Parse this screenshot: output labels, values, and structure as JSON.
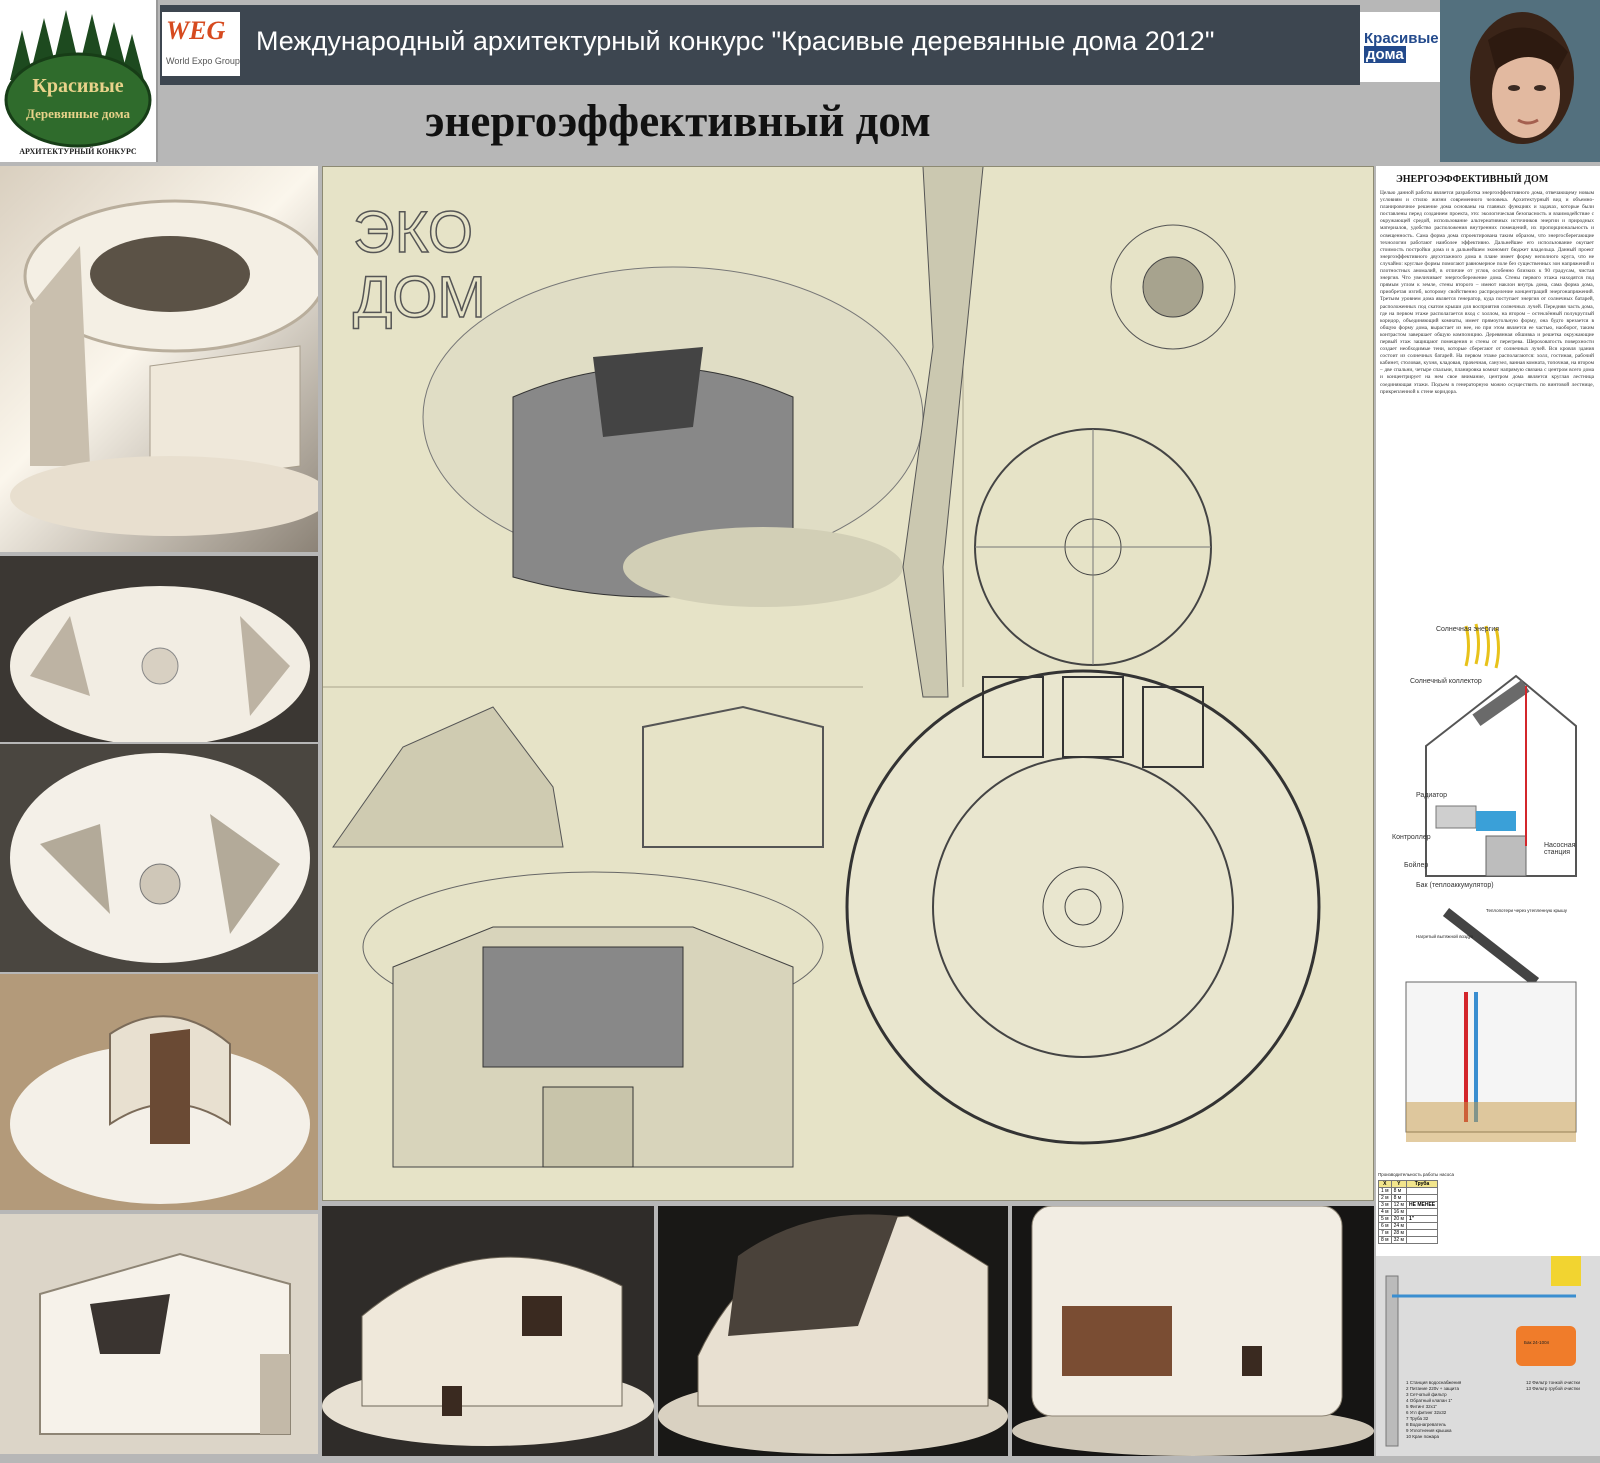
{
  "header": {
    "contest_title": "Международный архитектурный конкурс \"Красивые деревянные дома 2012\"",
    "page_title": "энергоэффективный дом",
    "left_logo": {
      "text_top": "Красивые",
      "text_bottom": "Деревянные дома",
      "caption": "АРХИТЕКТУРНЫЙ КОНКУРС"
    },
    "sponsor_logo": {
      "main": "WEG",
      "sub": "World Expo Group"
    },
    "magazine_logo": {
      "line1": "Красивые",
      "line2": "дома"
    }
  },
  "drawing": {
    "eco_label_1": "ЭКО",
    "eco_label_2": "ДОМ"
  },
  "text_panel": {
    "heading": "ЭНЕРГОЭФФЕКТИВНЫЙ ДОМ",
    "body": "Целью данной работы является разработка энергоэффективного дома, отвечающему новым условиям и стилю жизни современного человека. Архитектурный вид и объемно-планировочное решение дома основаны на главных функциях и задачах, которые были поставлены перед созданием проекта, это: экологическая безопасность и взаимодействие с окружающей средой, использование альтернативных источников энергии и природных материалов, удобство расположения внутренних помещений, их пропорциональность и освещенность. Сама форма дома спроектирована таким образом, что энергосберегающие технологии работают наиболее эффективно. Дальнейшее его использование окупает стоимость постройки дома и в дальнейшем экономит бюджет владельца. Данный проект энергоэффективного двухэтажного дома в плане имеет форму неполного круга, что не случайно: круглые формы помогают равномерное поле без существенных зон напряжений и плотностных аномалий, в отличие от углов, особенно близких к 90 градусам, чистая энергия. Что увеличивает энергосбережение дома. Стены первого этажа находятся под прямым углом к земле, стены второго – имеют наклон внутрь дома, сама форма дома, приобретая изгиб, которому свойственно распределение концентраций энергонапряжений. Третьим уровнем дома является генератор, куда поступает энергия от солнечных батарей, расположенных под скатом крыши для восприятия солнечных лучей. Передняя часть дома, где на первом этаже располагается вход с холлом, на втором – остеклённый полукруглый коридор, объединяющий комнаты, имеет прямоугольную форму, она будто врезается в общую форму дома, вырастает из нее, но при этом является ее частью, наоборот, таким контрастом завершает общую композицию. Деревянная обшивка и решетка окружающие первый этаж защищают помещения и стены от перегрева. Шероховатость поверхности создает необходимые тени, которые сберегают от солнечных лучей. Вся кровля здания состоит из солнечных батарей. На первом этаже располагаются: холл, гостиная, рабочий кабинет, столовая, кухня, кладовая, прачечная, санузел, ванная комната, топочная, на втором – две спальни, четыре спальни, планировка комнат напрямую связана с центром всего дома и концентрирует на нем свое внимание, центром дома является круглая лестница соединяющая этажи. Подъем в генераторную можно осуществить по винтовой лестнице, прикрепленной к стене коридора."
  },
  "solar_diagram": {
    "solar_energy": "Солнечная энергия",
    "solar_collector": "Солнечный коллектор",
    "radiator": "Радиатор",
    "controller": "Контроллер",
    "boiler": "Бойлер",
    "pump_station": "Насосная станция",
    "tank": "Бак (теплоаккумулятор)"
  },
  "ventilation_diagram": {
    "warm_air": "Нагретый вытяжной воздух",
    "heat_loss": "Теплопотери через утепленную крышу"
  },
  "pump_table": {
    "caption": "Производительность работы насоса",
    "headers": [
      "X",
      "Y",
      "Труба"
    ],
    "rows": [
      [
        "1 м",
        "8 м",
        ""
      ],
      [
        "2 м",
        "8 м",
        ""
      ],
      [
        "3 м",
        "12 м",
        "НЕ МЕНЕЕ"
      ],
      [
        "4 м",
        "16 м",
        ""
      ],
      [
        "5 м",
        "20 м",
        "1\""
      ],
      [
        "6 м",
        "24 м",
        ""
      ],
      [
        "7 м",
        "28 м",
        ""
      ],
      [
        "8 м",
        "32 м",
        ""
      ]
    ],
    "tank_label": "Бак 24-100л",
    "legend": [
      "1 Станция водоснабжения",
      "2 Питание 220v + защита",
      "3 Сетчатый фильтр",
      "4 Обратный клапан 1\"",
      "5 Фитинг 32x1\"",
      "6 Угл фитинг 32x32",
      "7 Труба 32",
      "8 Водонагреватель",
      "9 Уплотнения крышка",
      "10 Кран пожара",
      "12 Фильтр тонкой очистки",
      "13 Фильтр грубой очистки"
    ]
  },
  "colors": {
    "banner": "#3d4650",
    "background": "#b7b7b7",
    "sheet": "#e6e3c7",
    "weg_red": "#d64a1f",
    "magazine_blue": "#234a8c"
  }
}
